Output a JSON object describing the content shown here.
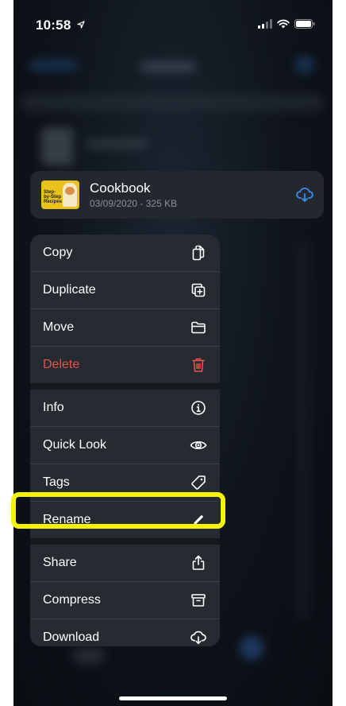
{
  "status_bar": {
    "time": "10:58"
  },
  "file": {
    "name": "Cookbook",
    "meta": "03/09/2020 - 325 KB",
    "thumb_text": "Step-by-Step Recipes"
  },
  "menu": [
    {
      "label": "Copy",
      "icon": "copy-icon"
    },
    {
      "label": "Duplicate",
      "icon": "duplicate-icon"
    },
    {
      "label": "Move",
      "icon": "folder-icon"
    },
    {
      "label": "Delete",
      "icon": "trash-icon",
      "destructive": true
    },
    {
      "label": "Info",
      "icon": "info-icon"
    },
    {
      "label": "Quick Look",
      "icon": "eye-icon"
    },
    {
      "label": "Tags",
      "icon": "tag-icon"
    },
    {
      "label": "Rename",
      "icon": "pencil-icon",
      "highlighted": true
    },
    {
      "label": "Share",
      "icon": "share-icon"
    },
    {
      "label": "Compress",
      "icon": "archive-icon"
    },
    {
      "label": "Download",
      "icon": "cloud-download-icon"
    }
  ],
  "colors": {
    "destructive": "#e5534b",
    "accent": "#3b8df0",
    "highlight": "#f5f20a"
  }
}
